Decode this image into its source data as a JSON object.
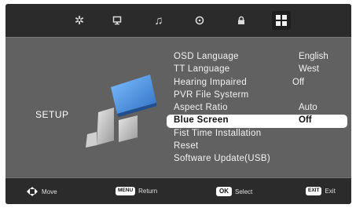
{
  "categories": [
    {
      "icon": "gear-icon",
      "glyph": "✲"
    },
    {
      "icon": "monitor-icon",
      "glyph": "🖵"
    },
    {
      "icon": "music-note-icon",
      "glyph": "♫"
    },
    {
      "icon": "clock-icon",
      "glyph": "◷"
    },
    {
      "icon": "lock-icon",
      "glyph": "🔒"
    },
    {
      "icon": "setup-grid-icon",
      "glyph": "▦"
    }
  ],
  "section_label": "SETUP",
  "menu_items": [
    {
      "label": "OSD Language",
      "value": "English"
    },
    {
      "label": "TT Language",
      "value": "West"
    },
    {
      "label": "Hearing Impaired",
      "value": "Off"
    },
    {
      "label": "PVR File Systerm",
      "value": ""
    },
    {
      "label": "Aspect Ratio",
      "value": "Auto"
    },
    {
      "label": "Blue Screen",
      "value": "Off"
    },
    {
      "label": "Fist Time Installation",
      "value": ""
    },
    {
      "label": "Reset",
      "value": ""
    },
    {
      "label": "Software Update(USB)",
      "value": ""
    }
  ],
  "selected_index": 5,
  "hints": {
    "move": "Move",
    "menu_key": "MENU",
    "return": "Return",
    "ok_key": "OK",
    "select": "Select",
    "exit_key": "EXIT",
    "exit": "Exit"
  },
  "colors": {
    "selection": "#ffffff",
    "logo_blue": "#3a86d8",
    "background": "#616161"
  }
}
